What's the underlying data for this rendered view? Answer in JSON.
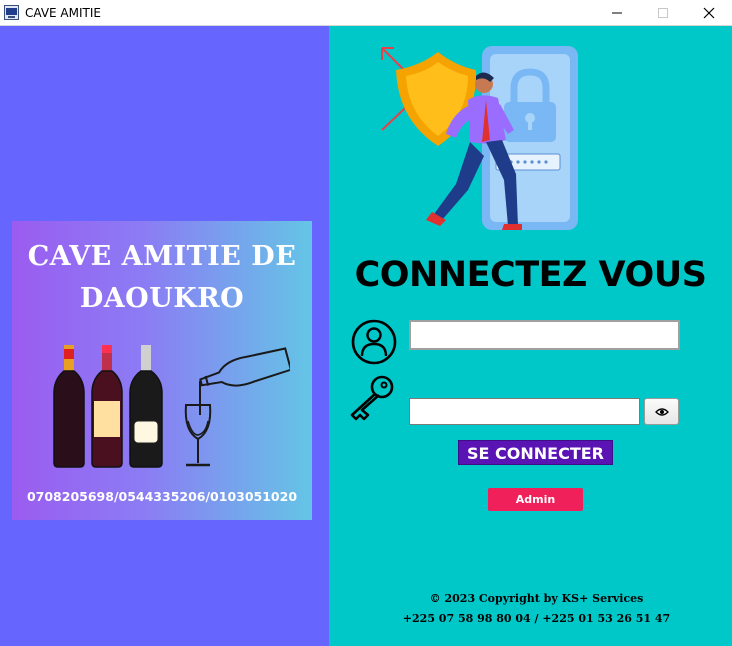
{
  "window": {
    "title": "CAVE AMITIE"
  },
  "left": {
    "title_line1": "CAVE AMITIE DE",
    "title_line2": "DAOUKRO",
    "phones": "0708205698/0544335206/0103051020"
  },
  "login": {
    "heading": "CONNECTEZ VOUS",
    "username_value": "",
    "password_value": "",
    "connect_label": "SE CONNECTER",
    "admin_label": "Admin"
  },
  "footer": {
    "copyright": "© 2023 Copyright by KS+ Services",
    "contact": "+225 07 58 98 80 04 / +225 01 53 26 51 47"
  },
  "colors": {
    "left_bg": "#6666ff",
    "right_bg": "#00c8c8",
    "connect_button": "#5b14b4",
    "admin_button": "#f0205a"
  },
  "icons": {
    "app": "app-icon",
    "user": "user-icon",
    "key": "key-icon",
    "eye": "eye-icon",
    "minimize": "minimize-icon",
    "maximize": "maximize-icon",
    "close": "close-icon"
  }
}
